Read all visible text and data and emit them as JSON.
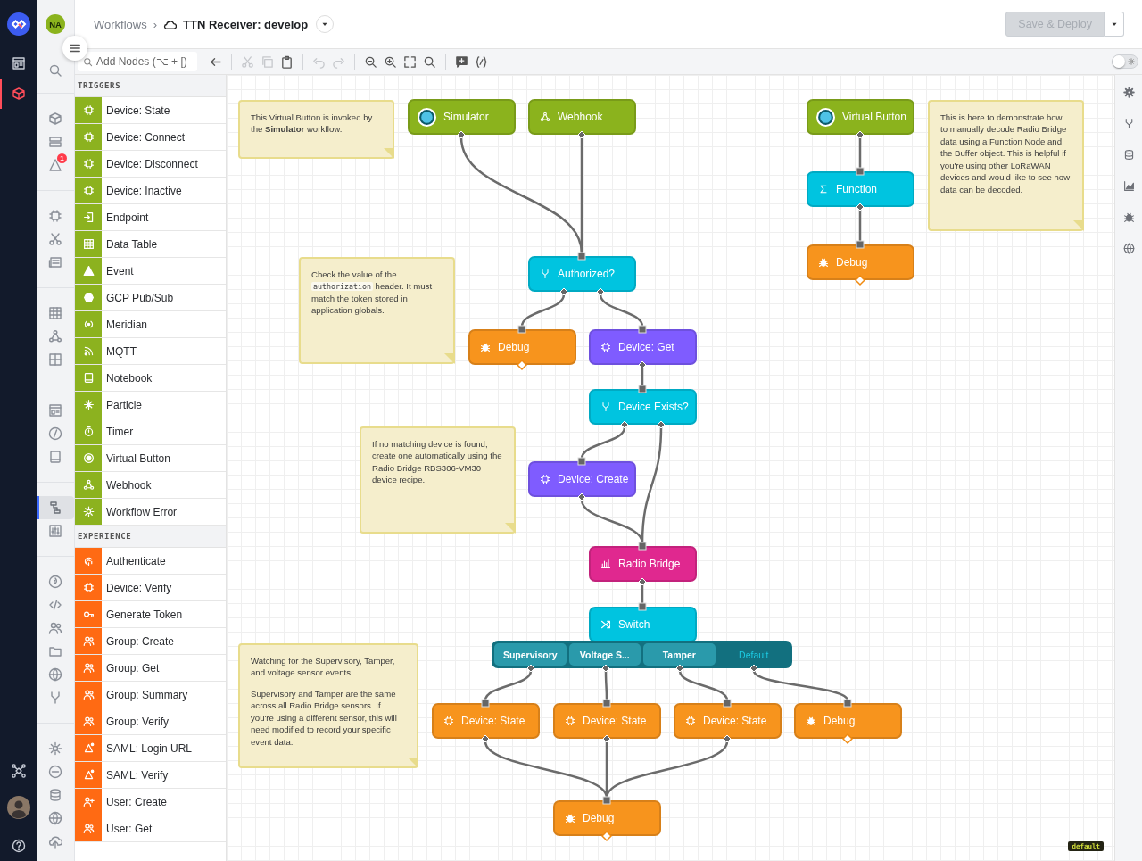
{
  "primary_nav": [
    {
      "selected": false
    },
    {
      "selected": true
    },
    {
      "selected": false
    }
  ],
  "user": {
    "initials": "NA"
  },
  "secondary_nav": {
    "groups": [
      {
        "items": [
          {
            "selected": false
          }
        ]
      },
      {
        "items": [
          {
            "selected": false
          },
          {
            "selected": false
          },
          {
            "selected": false,
            "badge": "1"
          }
        ]
      },
      {
        "items": [
          {
            "selected": false
          },
          {
            "selected": false
          },
          {
            "selected": false
          }
        ]
      },
      {
        "items": [
          {
            "selected": false
          },
          {
            "selected": false
          },
          {
            "selected": false
          }
        ]
      },
      {
        "items": [
          {
            "selected": false
          },
          {
            "selected": false
          },
          {
            "selected": false
          }
        ]
      },
      {
        "items": [
          {
            "selected": true
          },
          {
            "selected": false
          }
        ]
      },
      {
        "items": [
          {
            "selected": false
          },
          {
            "selected": false
          },
          {
            "selected": false
          },
          {
            "selected": false
          },
          {
            "selected": false
          },
          {
            "selected": false
          }
        ]
      },
      {
        "items": [
          {
            "selected": false
          },
          {
            "selected": false
          },
          {
            "selected": false
          },
          {
            "selected": false
          },
          {
            "selected": false
          }
        ]
      }
    ]
  },
  "header": {
    "breadcrumb": {
      "parent": "Workflows",
      "separator": "›",
      "title": "TTN Receiver: develop"
    },
    "save_button": {
      "label": "Save & Deploy",
      "disabled": true
    }
  },
  "toolbar": {
    "search": {
      "placeholder": "Add Nodes (⌥ + [)"
    },
    "buttons": [
      {
        "disabled": false
      },
      {
        "disabled": true
      },
      {
        "disabled": true
      },
      {
        "disabled": false
      },
      {
        "disabled": true
      },
      {
        "disabled": true
      },
      {
        "disabled": false
      },
      {
        "disabled": false
      },
      {
        "disabled": false
      },
      {
        "disabled": false
      },
      {
        "disabled": false
      },
      {
        "disabled": false
      }
    ],
    "toggle": {
      "on": false
    }
  },
  "palette": {
    "sections": [
      {
        "title": "TRIGGERS",
        "color": "#8cb21f",
        "items": [
          {
            "label": "Device: State"
          },
          {
            "label": "Device: Connect"
          },
          {
            "label": "Device: Disconnect"
          },
          {
            "label": "Device: Inactive"
          },
          {
            "label": "Endpoint"
          },
          {
            "label": "Data Table"
          },
          {
            "label": "Event"
          },
          {
            "label": "GCP Pub/Sub"
          },
          {
            "label": "Meridian"
          },
          {
            "label": "MQTT"
          },
          {
            "label": "Notebook"
          },
          {
            "label": "Particle"
          },
          {
            "label": "Timer"
          },
          {
            "label": "Virtual Button"
          },
          {
            "label": "Webhook"
          },
          {
            "label": "Workflow Error"
          }
        ]
      },
      {
        "title": "EXPERIENCE",
        "color": "#ff6a13",
        "items": [
          {
            "label": "Authenticate"
          },
          {
            "label": "Device: Verify"
          },
          {
            "label": "Generate Token"
          },
          {
            "label": "Group: Create"
          },
          {
            "label": "Group: Get"
          },
          {
            "label": "Group: Summary"
          },
          {
            "label": "Group: Verify"
          },
          {
            "label": "SAML: Login URL"
          },
          {
            "label": "SAML: Verify"
          },
          {
            "label": "User: Create"
          },
          {
            "label": "User: Get"
          }
        ]
      }
    ]
  },
  "canvas": {
    "nodes": [
      {
        "label": "Simulator",
        "kind": "virtual-button",
        "color": "#8bb31d"
      },
      {
        "label": "Webhook",
        "kind": "webhook",
        "color": "#8bb31d"
      },
      {
        "label": "Virtual Button",
        "kind": "virtual-button",
        "color": "#8bb31d"
      },
      {
        "label": "Function",
        "kind": "function",
        "color": "#00c4e0"
      },
      {
        "label": "Debug",
        "kind": "debug",
        "color": "#f7941d"
      },
      {
        "label": "Authorized?",
        "kind": "conditional",
        "color": "#00c4e0"
      },
      {
        "label": "Debug",
        "kind": "debug",
        "color": "#f7941d"
      },
      {
        "label": "Device: Get",
        "kind": "device",
        "color": "#7f5cff"
      },
      {
        "label": "Device Exists?",
        "kind": "conditional",
        "color": "#00c4e0"
      },
      {
        "label": "Device: Create",
        "kind": "device",
        "color": "#7f5cff"
      },
      {
        "label": "Radio Bridge",
        "kind": "radio-bridge",
        "color": "#e0288f"
      },
      {
        "label": "Switch",
        "kind": "switch",
        "color": "#00c4e0",
        "outputs": [
          {
            "label": "Supervisory",
            "kind": "case"
          },
          {
            "label": "Voltage S...",
            "kind": "case"
          },
          {
            "label": "Tamper",
            "kind": "case"
          },
          {
            "label": "Default",
            "kind": "default"
          }
        ]
      },
      {
        "label": "Device: State",
        "kind": "device",
        "color": "#f7941d"
      },
      {
        "label": "Device: State",
        "kind": "device",
        "color": "#f7941d"
      },
      {
        "label": "Device: State",
        "kind": "device",
        "color": "#f7941d"
      },
      {
        "label": "Debug",
        "kind": "debug",
        "color": "#f7941d"
      },
      {
        "label": "Debug",
        "kind": "debug",
        "color": "#f7941d"
      }
    ],
    "notes": [
      {
        "paragraphs": [
          [
            {
              "kind": "text",
              "text": "This Virtual Button is invoked by the **Simulator** workflow."
            }
          ]
        ]
      },
      {
        "paragraphs": [
          [
            {
              "kind": "text",
              "text": "Check the value of the "
            },
            {
              "kind": "code",
              "text": "authorization"
            },
            {
              "kind": "text",
              "text": " header. It must match the token stored in application globals."
            }
          ]
        ]
      },
      {
        "paragraphs": [
          [
            {
              "kind": "text",
              "text": "If no matching device is found, create one automatically using the Radio Bridge RBS306-VM30 device recipe."
            }
          ]
        ]
      },
      {
        "paragraphs": [
          [
            {
              "kind": "text",
              "text": "Watching for the Supervisory, Tamper, and voltage sensor events."
            }
          ],
          [
            {
              "kind": "text",
              "text": "Supervisory and Tamper are the same across all Radio Bridge sensors. If you're using a different sensor, this will need modified to record your specific event data."
            }
          ]
        ]
      },
      {
        "paragraphs": [
          [
            {
              "kind": "text",
              "text": "This is here to demonstrate how to manually decode Radio Bridge data using a Function Node and the Buffer object. This is helpful if you're using other LoRaWAN devices and would like to see how data can be decoded."
            }
          ]
        ]
      }
    ],
    "environment_badge": "default"
  }
}
